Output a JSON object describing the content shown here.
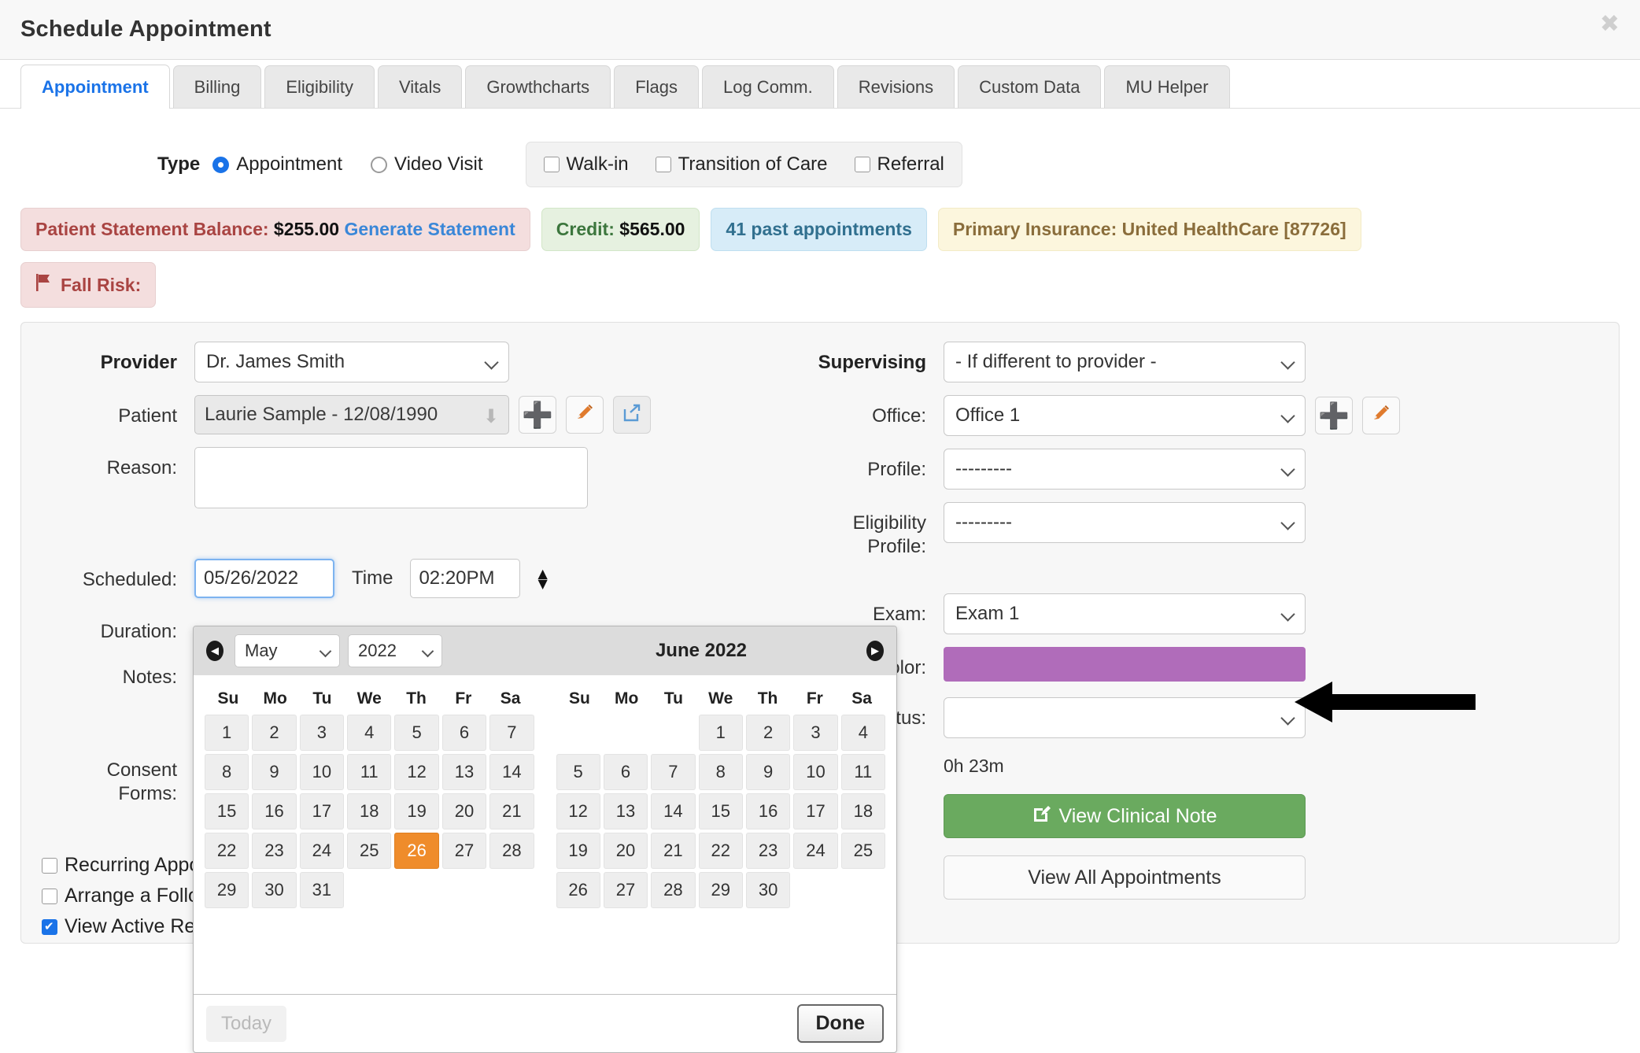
{
  "window": {
    "title": "Schedule Appointment",
    "close_icon": "close-icon"
  },
  "tabs": [
    {
      "label": "Appointment",
      "active": true
    },
    {
      "label": "Billing",
      "active": false
    },
    {
      "label": "Eligibility",
      "active": false
    },
    {
      "label": "Vitals",
      "active": false
    },
    {
      "label": "Growthcharts",
      "active": false
    },
    {
      "label": "Flags",
      "active": false
    },
    {
      "label": "Log Comm.",
      "active": false
    },
    {
      "label": "Revisions",
      "active": false
    },
    {
      "label": "Custom Data",
      "active": false
    },
    {
      "label": "MU Helper",
      "active": false
    }
  ],
  "type_row": {
    "label": "Type",
    "radios": [
      {
        "label": "Appointment",
        "checked": true
      },
      {
        "label": "Video Visit",
        "checked": false
      }
    ],
    "checkboxes": [
      {
        "label": "Walk-in",
        "checked": false
      },
      {
        "label": "Transition of Care",
        "checked": false
      },
      {
        "label": "Referral",
        "checked": false
      }
    ]
  },
  "banners": {
    "balance_label": "Patient Statement Balance:",
    "balance_amount": "$255.00",
    "generate_statement": "Generate Statement",
    "credit_label": "Credit:",
    "credit_amount": "$565.00",
    "past_appointments": "41 past appointments",
    "insurance": "Primary Insurance: United HealthCare [87726]",
    "fall_risk": "Fall Risk:",
    "fall_risk_icon": "flag-icon"
  },
  "form": {
    "provider_label": "Provider",
    "provider_value": "Dr. James Smith",
    "patient_label": "Patient",
    "patient_value": "Laurie Sample - 12/08/1990",
    "patient_add_icon": "plus-icon",
    "patient_edit_icon": "pencil-icon",
    "patient_share_icon": "share-arrow-icon",
    "reason_label": "Reason:",
    "reason_value": "",
    "scheduled_label": "Scheduled:",
    "scheduled_value": "05/26/2022",
    "time_label": "Time",
    "time_value": "02:20PM",
    "time_spinner_icon": "up-down-spinner-icon",
    "duration_label": "Duration:",
    "notes_label": "Notes:",
    "consent_label": "Consent Forms:",
    "supervising_label": "Supervising",
    "supervising_value": "- If different to provider -",
    "office_label": "Office:",
    "office_value": "Office 1",
    "office_add_icon": "plus-icon",
    "office_edit_icon": "pencil-icon",
    "profile_label": "Profile:",
    "profile_value": "---------",
    "eligibility_label": "Eligibility Profile:",
    "eligibility_value": "---------",
    "exam_label": "Exam:",
    "exam_value": "Exam 1",
    "color_label": "Color:",
    "color_value": "#b06cba",
    "status_label": "Status:",
    "status_value": "",
    "duration_text": "0h 23m",
    "view_clinical_note": "View Clinical Note",
    "view_clinical_note_icon": "note-edit-icon",
    "view_all_appointments": "View All Appointments"
  },
  "bottom_checkboxes": [
    {
      "label": "Recurring Appointment",
      "checked": false
    },
    {
      "label": "Arrange a Follow-up",
      "checked": false
    },
    {
      "label": "View Active Reminders",
      "checked": true
    }
  ],
  "datepicker": {
    "prev_icon": "chevron-left-circle-icon",
    "next_icon": "chevron-right-circle-icon",
    "month_select": "May",
    "year_select": "2022",
    "second_month_title": "June 2022",
    "dow": [
      "Su",
      "Mo",
      "Tu",
      "We",
      "Th",
      "Fr",
      "Sa"
    ],
    "month1": {
      "name": "May 2022",
      "lead_blanks": 0,
      "days": 31,
      "selected": 26
    },
    "month2": {
      "name": "June 2022",
      "lead_blanks": 3,
      "days": 30,
      "selected": null
    },
    "today_label": "Today",
    "done_label": "Done"
  },
  "annotation": {
    "arrow_icon": "left-pointing-arrow",
    "points_to": "status-dropdown"
  }
}
